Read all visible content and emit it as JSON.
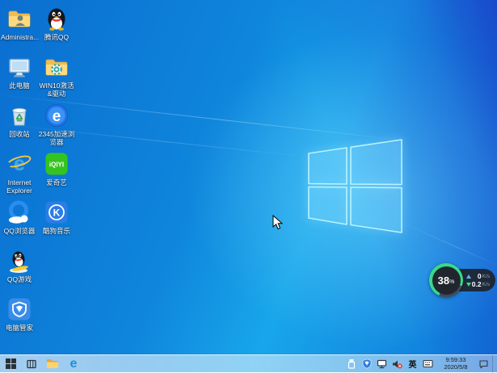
{
  "colors": {
    "accent_blue": "#0078d7",
    "wallpaper_deep_blue": "#1a42c8",
    "wallpaper_bright_cyan": "#2ab3ef",
    "widget_green": "#39d98a",
    "widget_up_blue": "#58b6ff"
  },
  "desktop_icons": [
    {
      "label": "Administra...",
      "name": "administrator-folder"
    },
    {
      "label": "腾讯QQ",
      "name": "tencent-qq"
    },
    {
      "label": "此电脑",
      "name": "this-pc"
    },
    {
      "label": "WIN10激活&驱动",
      "name": "win10-activation-folder"
    },
    {
      "label": "回收站",
      "name": "recycle-bin"
    },
    {
      "label": "2345加速浏览器",
      "name": "2345-browser",
      "glyph": "e"
    },
    {
      "label": "Internet Explorer",
      "name": "internet-explorer",
      "glyph": "e"
    },
    {
      "label": "爱奇艺",
      "name": "iqiyi",
      "glyph": "iQIYI"
    },
    {
      "label": "QQ浏览器",
      "name": "qq-browser"
    },
    {
      "label": "酷狗音乐",
      "name": "kugou-music",
      "glyph": "K"
    },
    {
      "label": "QQ游戏",
      "name": "qq-games"
    },
    {
      "label": "电脑管家",
      "name": "pc-manager"
    }
  ],
  "taskbar": {
    "edge_glyph": "e",
    "ime_label": "英",
    "clock": {
      "time": "9:59:33",
      "date": "2020/5/8"
    }
  },
  "widget": {
    "percent": "38",
    "percent_unit": "%",
    "upload": {
      "value": "0",
      "unit": "K/s"
    },
    "download": {
      "value": "0.2",
      "unit": "K/s"
    }
  }
}
